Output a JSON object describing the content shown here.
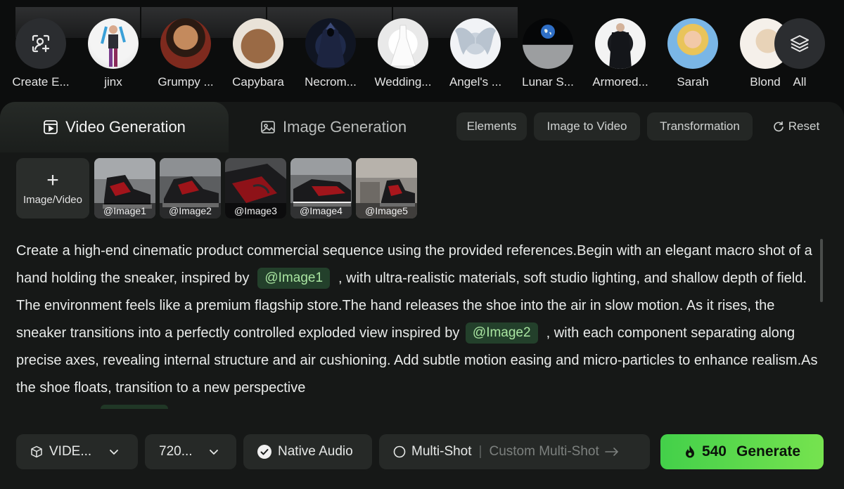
{
  "elements": {
    "create_label": "Create E...",
    "items": [
      {
        "label": "jinx"
      },
      {
        "label": "Grumpy ..."
      },
      {
        "label": "Capybara"
      },
      {
        "label": "Necrom..."
      },
      {
        "label": "Wedding..."
      },
      {
        "label": "Angel's ..."
      },
      {
        "label": "Lunar S..."
      },
      {
        "label": "Armored..."
      },
      {
        "label": "Sarah"
      },
      {
        "label": "Blond"
      }
    ],
    "all_label": "All"
  },
  "tabs": {
    "video": "Video Generation",
    "image": "Image Generation"
  },
  "modes": [
    "Elements",
    "Image to Video",
    "Transformation"
  ],
  "reset_label": "Reset",
  "upload_label": "Image/Video",
  "references": [
    "@Image1",
    "@Image2",
    "@Image3",
    "@Image4",
    "@Image5"
  ],
  "prompt": {
    "p1": "Create a high-end cinematic product commercial sequence using the provided references.Begin with an elegant macro shot of a hand holding the sneaker, inspired by",
    "tag1": "@Image1",
    "p2": ", with ultra-realistic materials, soft studio lighting, and shallow depth of field. The environment feels like a premium flagship store.The hand releases the shoe into the air in slow motion. As it rises, the sneaker transitions into a perfectly controlled exploded view inspired by",
    "tag2": "@Image2",
    "p3": ", with each component separating along precise axes, revealing internal structure and air cushioning. Add subtle motion easing and micro-particles to enhance realism.As the shoe floats, transition to a new perspective"
  },
  "toolbar": {
    "model": "VIDE...",
    "resolution": "720...",
    "native_audio": "Native Audio",
    "multi_shot": "Multi-Shot",
    "custom_multi_shot": "Custom Multi-Shot",
    "credits": "540",
    "generate": "Generate"
  },
  "colors": {
    "accent_green": "#5ad84c",
    "tag_bg": "#23402b",
    "tag_text": "#a9e5a1",
    "panel_bg": "#161817"
  }
}
